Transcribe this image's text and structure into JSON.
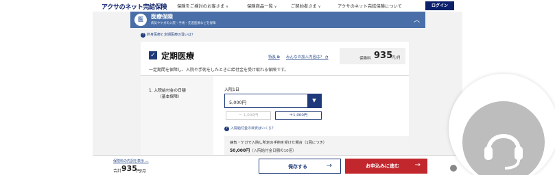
{
  "header": {
    "logo": "アクサのネット完結保険",
    "nav": [
      {
        "label": "保険をご検討のお客さま"
      },
      {
        "label": "保険商品一覧"
      },
      {
        "label": "ご契約者さま"
      },
      {
        "label": "アクサのネット完結保険について"
      }
    ],
    "login_label": "ログイン"
  },
  "section": {
    "icon_text": "医",
    "title": "医療保険",
    "subtitle": "病気やケガの入院・手術・先進医療などを保障",
    "toggle": "︿"
  },
  "diff_link": "終身医療と定期医療の違いは？",
  "plan": {
    "title": "定期医療",
    "tokuyaku_link": "特長",
    "everyone_link": "みんなの加入内容は？",
    "fee_label": "保険料",
    "fee_value": "935",
    "fee_unit": "円/月",
    "description": "一定期間を保障し、入院や手術をしたときに給付金を受け取れる保険です。"
  },
  "benefit": {
    "item_label": "1. 入院給付金の日額",
    "item_sub": "（基本保障）",
    "day_label": "入院1日",
    "selected_value": "5,000円",
    "minus_label": "－ 1,000円",
    "plus_label": "＋1,000円",
    "guide_link": "入院給付金の目安はいくら？",
    "info_title": "病気・ケガで入院し所定の手術を受けた場合（1回につき）",
    "info_value": "50,000円",
    "info_note": "（入院給付金日額の10倍）"
  },
  "footer": {
    "breakdown_link": "保険料の内訳を表示 ︿",
    "total_label": "合計",
    "total_value": "935",
    "total_unit": "円/月",
    "save_label": "保存する",
    "apply_label": "お申込みに進む"
  },
  "colors": {
    "brand_navy": "#0b1f6b",
    "section_blue": "#4a6fa8",
    "apply_red": "#c1272d"
  }
}
